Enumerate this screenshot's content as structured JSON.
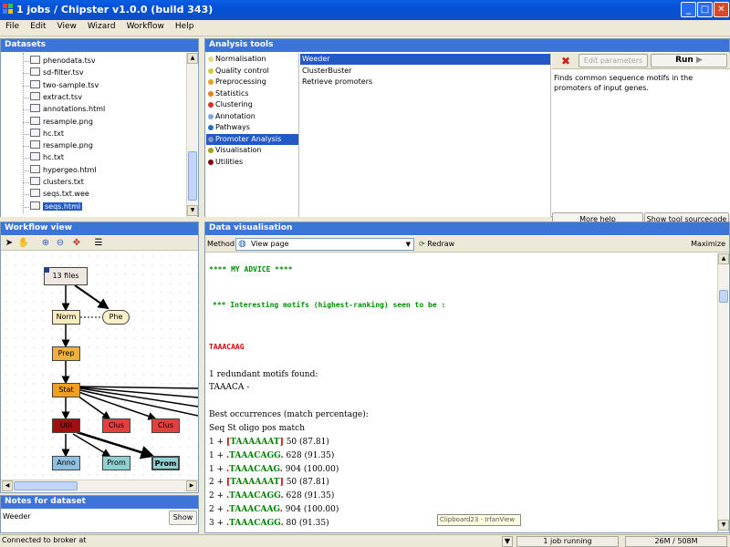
{
  "window": {
    "title": "1 jobs / Chipster v1.0.0 (build 343)"
  },
  "menu": [
    "File",
    "Edit",
    "View",
    "Wizard",
    "Workflow",
    "Help"
  ],
  "datasets": {
    "header": "Datasets",
    "files": [
      "phenodata.tsv",
      "sd-filter.tsv",
      "two-sample.tsv",
      "extract.tsv",
      "annotations.html",
      "resample.png",
      "hc.txt",
      "resample.png",
      "hc.txt",
      "hypergeo.html",
      "clusters.txt",
      "seqs.txt.wee",
      "seqs.html"
    ],
    "selected": "seqs.html"
  },
  "analysis_tools": {
    "header": "Analysis tools",
    "categories": [
      {
        "label": "Normalisation",
        "color": "#e8d878"
      },
      {
        "label": "Quality control",
        "color": "#d8c83a"
      },
      {
        "label": "Preprocessing",
        "color": "#e8a020"
      },
      {
        "label": "Statistics",
        "color": "#e88020"
      },
      {
        "label": "Clustering",
        "color": "#d83020"
      },
      {
        "label": "Annotation",
        "color": "#80a8d8"
      },
      {
        "label": "Pathways",
        "color": "#2070c0"
      },
      {
        "label": "Promoter Analysis",
        "color": "#7a9ab8"
      },
      {
        "label": "Visualisation",
        "color": "#a0a020"
      },
      {
        "label": "Utilities",
        "color": "#800000"
      }
    ],
    "selected_category": "Promoter Analysis",
    "tools": [
      "Weeder",
      "ClusterBuster",
      "Retrieve promoters"
    ],
    "selected_tool": "Weeder",
    "edit_parameters_label": "Edit parameters",
    "run_label": "Run",
    "description": "Finds common sequence motifs in the promoters of input genes.",
    "more_help_label": "More help",
    "show_source_label": "Show tool sourcecode"
  },
  "workflow": {
    "header": "Workflow view",
    "nodes": {
      "files": "13 files",
      "norm": "Norm",
      "phe": "Phe",
      "prep": "Prep",
      "stat": "Stat",
      "util": "Util",
      "clus1": "Clus",
      "clus2": "Clus",
      "anno": "Anno",
      "prom1": "Prom",
      "prom2": "Prom"
    }
  },
  "notes": {
    "header": "Notes for dataset",
    "text": "Weeder",
    "show_label": "Show"
  },
  "visualisation": {
    "header": "Data visualisation",
    "method_label": "Method:",
    "method_value": "View page",
    "redraw_label": "Redraw",
    "maximize_label": "Maximize",
    "advice": "**** MY ADVICE ****",
    "interesting": "*** Interesting motifs (highest-ranking) seen to be :",
    "top_motif": "TAAACAAG",
    "redundant": "1 redundant motifs found:",
    "redundant_motif": "TAAACA -",
    "best_occ": "Best occurrences (match percentage):",
    "columns": "Seq St oligo pos match",
    "rows": [
      {
        "prefix": "1 + ",
        "open": "[",
        "motif": "TAAAAAAT",
        "close": "]",
        "suffix": " 50 (87.81)"
      },
      {
        "prefix": "1 + ",
        "open": ".",
        "motif": "TAAACAGG",
        "close": ".",
        "suffix": " 628 (91.35)"
      },
      {
        "prefix": "1 + ",
        "open": ".",
        "motif": "TAAACAAG",
        "close": ".",
        "suffix": " 904 (100.00)"
      },
      {
        "prefix": "2 + ",
        "open": "[",
        "motif": "TAAAAAAT",
        "close": "]",
        "suffix": " 50 (87.81)"
      },
      {
        "prefix": "2 + ",
        "open": ".",
        "motif": "TAAACAGG",
        "close": ".",
        "suffix": " 628 (91.35)"
      },
      {
        "prefix": "2 + ",
        "open": ".",
        "motif": "TAAACAAG",
        "close": ".",
        "suffix": " 904 (100.00)"
      },
      {
        "prefix": "3 + ",
        "open": ".",
        "motif": "TAAACAGG",
        "close": ".",
        "suffix": " 80 (91.35)"
      }
    ]
  },
  "status": {
    "connection": "Connected to broker at ",
    "jobs": "1 job running",
    "memory": "26M / 508M"
  },
  "tooltip": "Clipboard23 - IrfanView"
}
